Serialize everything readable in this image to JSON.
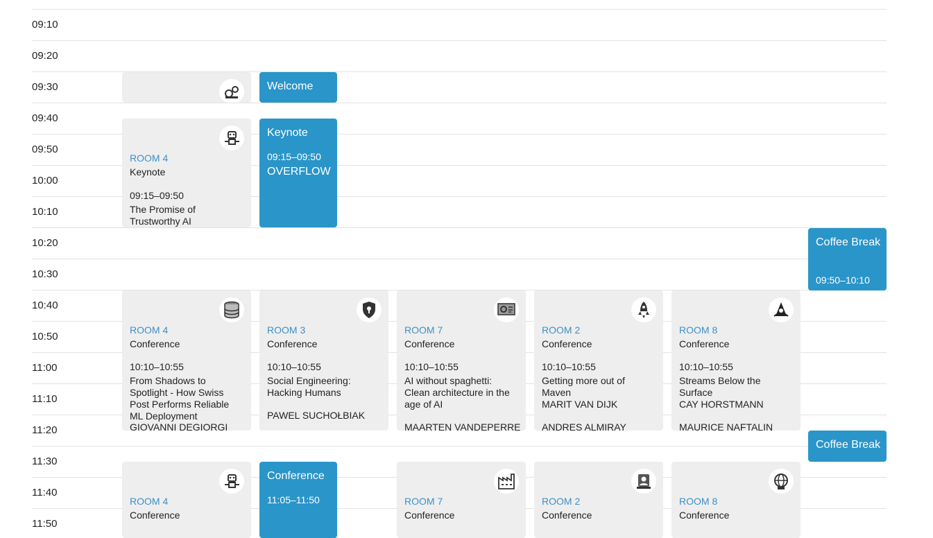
{
  "times": [
    "09:10",
    "09:20",
    "09:30",
    "09:40",
    "09:50",
    "10:00",
    "10:10",
    "10:20",
    "10:30",
    "10:40",
    "10:50",
    "11:00",
    "11:10",
    "11:20",
    "11:30",
    "11:40",
    "11:50"
  ],
  "welcome": {
    "title": "Welcome"
  },
  "keynote_overflow": {
    "title": "Keynote",
    "time": "09:15–09:50",
    "subtitle": "OVERFLOW"
  },
  "keynote_room4": {
    "room": "ROOM 4",
    "kind": "Keynote",
    "time": "09:15–09:50",
    "title": "The Promise of Trustworthy AI"
  },
  "coffee1": {
    "title": "Coffee Break",
    "time": "09:50–10:10"
  },
  "coffee2": {
    "title": "Coffee Break"
  },
  "conf_1010": [
    {
      "room": "ROOM 4",
      "kind": "Conference",
      "time": "10:10–10:55",
      "title": "From Shadows to Spotlight - How Swiss Post Performs Reliable ML Deployment",
      "speaker1": "GIOVANNI DEGIORGI",
      "speaker2": ""
    },
    {
      "room": "ROOM 3",
      "kind": "Conference",
      "time": "10:10–10:55",
      "title": "Social Engineering: Hacking Humans",
      "speaker1": "PAWEL SUCHOŁBIAK",
      "speaker2": ""
    },
    {
      "room": "ROOM 7",
      "kind": "Conference",
      "time": "10:10–10:55",
      "title": "AI without spaghetti: Clean architecture in the age of AI",
      "speaker1": "MAARTEN VANDEPERRE",
      "speaker2": ""
    },
    {
      "room": "ROOM 2",
      "kind": "Conference",
      "time": "10:10–10:55",
      "title": "Getting more out of Maven",
      "speaker1": "MARIT VAN DIJK",
      "speaker2": "ANDRES ALMIRAY"
    },
    {
      "room": "ROOM 8",
      "kind": "Conference",
      "time": "10:10–10:55",
      "title": "Streams Below the Surface",
      "speaker1": "CAY HORSTMANN",
      "speaker2": "MAURICE NAFTALIN"
    }
  ],
  "conf_1105_blue": {
    "title": "Conference",
    "time": "11:05–11:50"
  },
  "conf_1105": [
    {
      "room": "ROOM 4",
      "kind": "Conference"
    },
    {
      "room": "ROOM 7",
      "kind": "Conference"
    },
    {
      "room": "ROOM 2",
      "kind": "Conference"
    },
    {
      "room": "ROOM 8",
      "kind": "Conference"
    }
  ],
  "colors": {
    "accent": "#2a95c9",
    "card_bg": "#eeeeee",
    "room_text": "#3d90c6"
  },
  "icons": [
    "gears-icon",
    "robot-icon",
    "database-icon",
    "security-shield-icon",
    "settings-monitor-icon",
    "rocket-icon",
    "java-duke-icon",
    "factory-icon",
    "user-gear-icon",
    "ai-globe-icon"
  ]
}
